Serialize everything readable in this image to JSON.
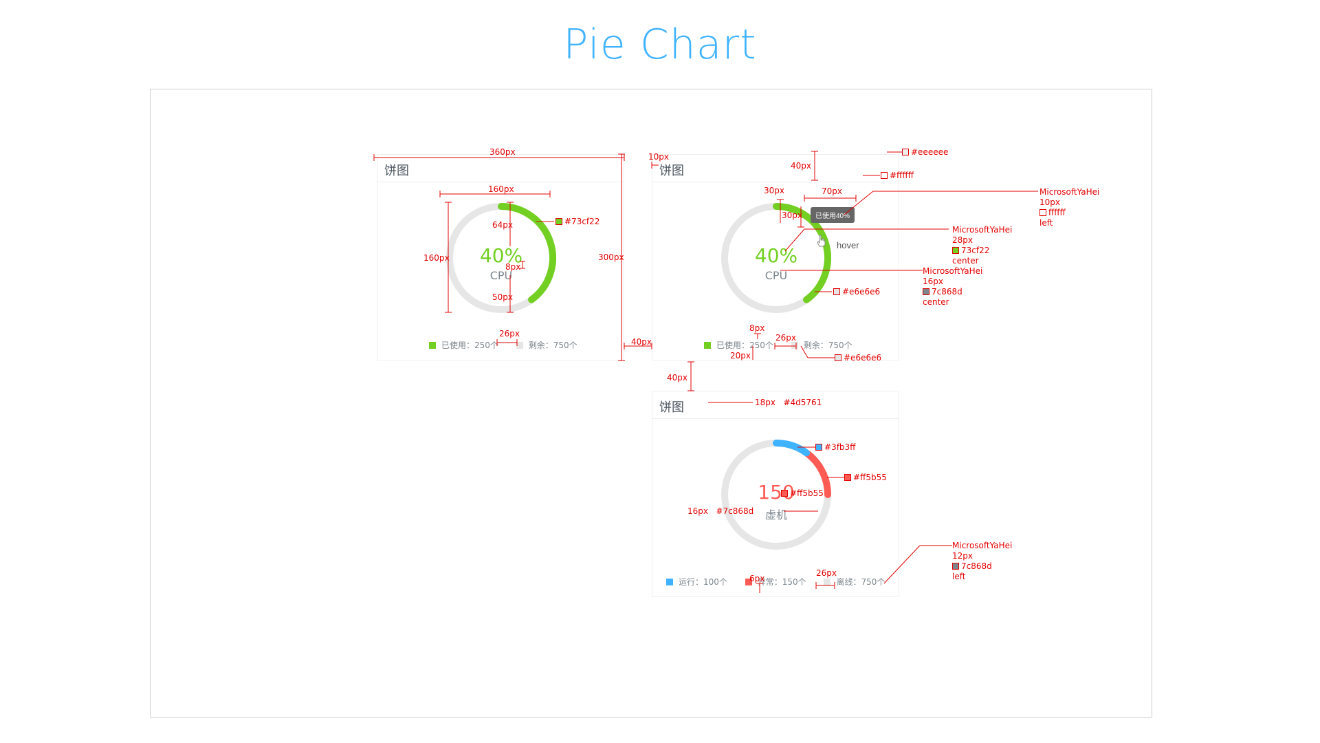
{
  "page_title": "Pie Chart",
  "colors": {
    "green": "#73cf22",
    "blue": "#3fb3ff",
    "red": "#ff5b55",
    "track": "#e6e6e6",
    "text": "#7c868d",
    "title": "#4d5761",
    "annot": "#e30000"
  },
  "card1": {
    "title": "饼图",
    "value": "40%",
    "label": "CPU",
    "used_fraction": 0.4,
    "legend": [
      {
        "color": "#73cf22",
        "text": "已使用：250个"
      },
      {
        "color": "#e6e6e6",
        "text": "剩余：750个"
      }
    ]
  },
  "card2": {
    "title": "饼图",
    "value": "40%",
    "label": "CPU",
    "used_fraction": 0.4,
    "tooltip": "已使用40%",
    "hover": "hover",
    "legend": [
      {
        "color": "#73cf22",
        "text": "已使用：250个"
      },
      {
        "color": "#e6e6e6",
        "text": "剩余：750个"
      }
    ]
  },
  "card3": {
    "title": "饼图",
    "value": "150",
    "label": "虚机",
    "segments": [
      {
        "color": "#3fb3ff",
        "fraction": 0.1
      },
      {
        "color": "#ff5b55",
        "fraction": 0.15
      }
    ],
    "legend": [
      {
        "color": "#3fb3ff",
        "text": "运行：100个"
      },
      {
        "color": "#ff5b55",
        "text": "异常：150个"
      },
      {
        "color": "#e6e6e6",
        "text": "离线：750个"
      }
    ]
  },
  "annotations": {
    "w360": "360px",
    "w160": "160px",
    "h160": "160px",
    "h64": "64px",
    "h8": "8px",
    "h50": "50px",
    "h300": "300px",
    "w40a": "40px",
    "w26a": "26px",
    "c_green": "#73cf22",
    "w10": "10px",
    "h40": "40px",
    "h30a": "30px",
    "w70": "70px",
    "h30b": "30px",
    "c_eee": "#eeeeee",
    "c_fff": "#ffffff",
    "tip_spec": [
      "MicrosoftYaHei",
      "10px",
      "ffffff",
      "left"
    ],
    "val_spec": [
      "MicrosoftYaHei",
      "28px",
      "73cf22",
      "center"
    ],
    "lbl_spec": [
      "MicrosoftYaHei",
      "16px",
      "7c868d",
      "center"
    ],
    "c_track": "#e6e6e6",
    "w8": "8px",
    "w26b": "26px",
    "h20": "20px",
    "c_track2": "#e6e6e6",
    "h40b": "40px",
    "title_size": "18px",
    "title_color": "#4d5761",
    "c_blue": "#3fb3ff",
    "c_red": "#ff5b55",
    "c_red2": "#ff5b55",
    "lbl3_size": "16px",
    "lbl3_color": "#7c868d",
    "legend_spec": [
      "MicrosoftYaHei",
      "12px",
      "7c868d",
      "left"
    ],
    "w6": "6px",
    "w26c": "26px"
  }
}
